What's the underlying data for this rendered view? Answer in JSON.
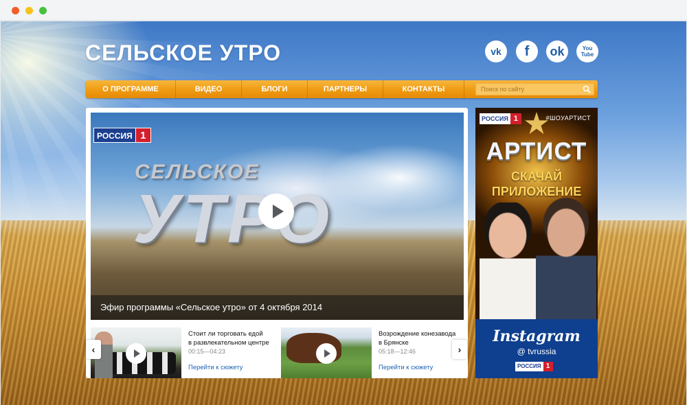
{
  "site": {
    "logo": "СЕЛЬСКОЕ УТРО"
  },
  "social": {
    "vk": "vk",
    "fb": "f",
    "ok": "ok",
    "yt_top": "You",
    "yt_bottom": "Tube"
  },
  "nav": {
    "items": [
      "О ПРОГРАММЕ",
      "ВИДЕО",
      "БЛОГИ",
      "ПАРТНЕРЫ",
      "КОНТАКТЫ"
    ],
    "search_placeholder": "Поиск по сайту"
  },
  "player": {
    "channel_name": "РОССИЯ",
    "channel_number": "1",
    "title_small": "СЕЛЬСКОЕ",
    "title_big": "УТРО",
    "caption": "Эфир программы «Сельское утро» от 4 октября 2014"
  },
  "related": [
    {
      "title_line1": "Стоит ли торговать едой",
      "title_line2": "в развлекательном центре",
      "time": "00:15—04:23",
      "link": "Перейти к сюжету"
    },
    {
      "title_line1": "Возрождение конезавода",
      "title_line2": "в Брянске",
      "time": "05:18—12:46",
      "link": "Перейти к сюжету"
    }
  ],
  "arrows": {
    "prev": "‹",
    "next": "›"
  },
  "banner": {
    "channel_name": "РОССИЯ",
    "channel_number": "1",
    "hashtag": "#ШОУАРТИСТ",
    "title": "АРТИСТ",
    "cta_line1": "СКАЧАЙ",
    "cta_line2": "ПРИЛОЖЕНИЕ",
    "instagram_brand": "Instagram",
    "instagram_handle": "@ tvrussia",
    "footer_channel_name": "РОССИЯ",
    "footer_channel_number": "1"
  },
  "colors": {
    "accent": "#ef9b12",
    "link": "#1c62b4",
    "channel_blue": "#1c3f8f",
    "channel_red": "#d31f2c"
  }
}
